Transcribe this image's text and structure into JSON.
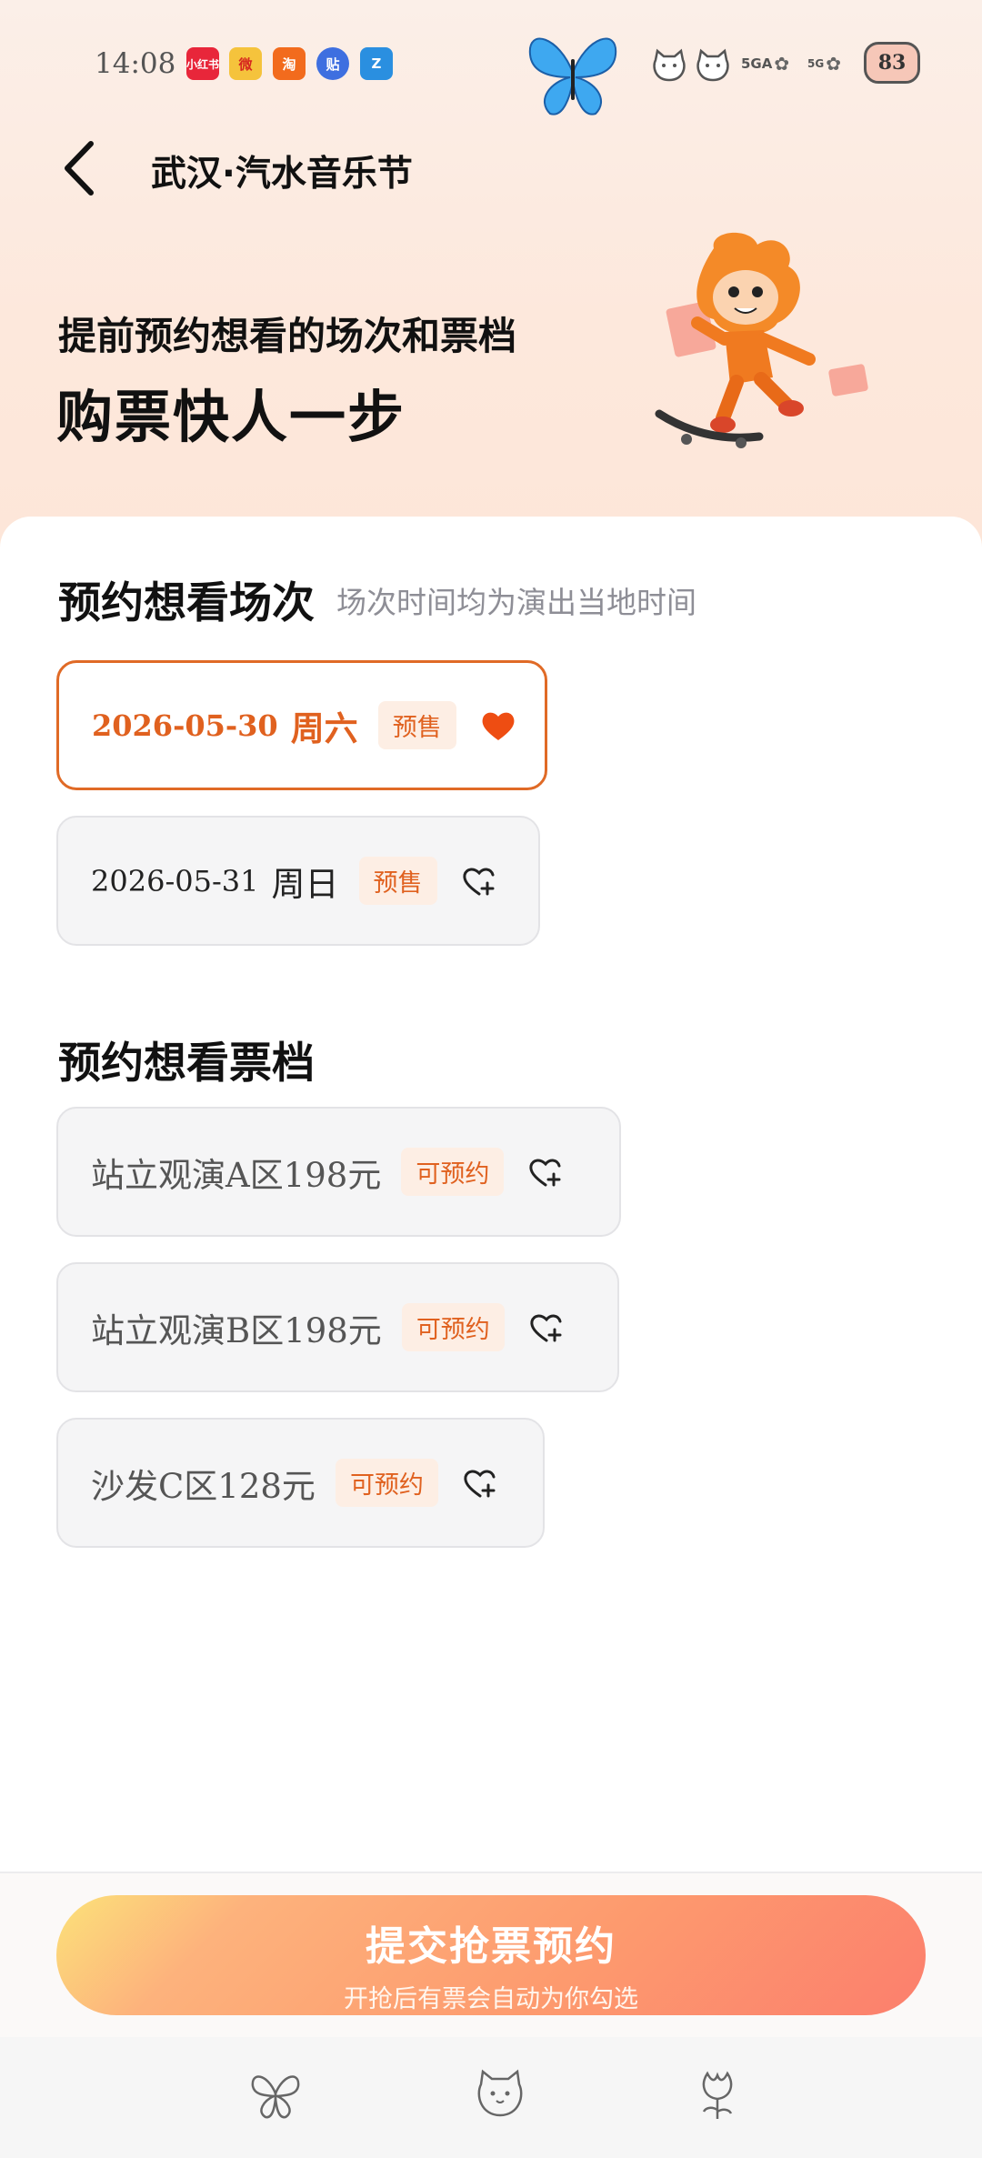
{
  "status_bar": {
    "time": "14:08",
    "apps": [
      {
        "name": "xiaohongshu-icon",
        "label": "小红书",
        "color": "#e8263a"
      },
      {
        "name": "weibo-icon",
        "label": "微",
        "color": "#f5c33c"
      },
      {
        "name": "taobao-icon",
        "label": "淘",
        "color": "#f26b1d"
      },
      {
        "name": "tieba-icon",
        "label": "贴",
        "color": "#3e6fe0"
      },
      {
        "name": "zhejiang-tv-icon",
        "label": "Z",
        "color": "#2a8fe0"
      }
    ],
    "net1": "5GA",
    "net2": "5G",
    "battery": "83"
  },
  "nav": {
    "title": "武汉·汽水音乐节"
  },
  "hero": {
    "subtitle": "提前预约想看的场次和票档",
    "title": "购票快人一步"
  },
  "sessions": {
    "title": "预约想看场次",
    "note": "场次时间均为演出当地时间",
    "items": [
      {
        "date": "2026-05-30",
        "day": "周六",
        "badge": "预售",
        "selected": true
      },
      {
        "date": "2026-05-31",
        "day": "周日",
        "badge": "预售",
        "selected": false
      }
    ]
  },
  "tickets": {
    "title": "预约想看票档",
    "items": [
      {
        "name": "站立观演A区198元",
        "badge": "可预约"
      },
      {
        "name": "站立观演B区198元",
        "badge": "可预约"
      },
      {
        "name": "沙发C区128元",
        "badge": "可预约"
      }
    ]
  },
  "submit": {
    "label": "提交抢票预约",
    "sublabel": "开抢后有票会自动为你勾选"
  },
  "bottom_bar": {
    "icons": [
      "butterfly-icon",
      "cat-face-icon",
      "tulip-icon"
    ]
  },
  "colors": {
    "accent": "#e0611f",
    "badge_bg": "#fdeee4",
    "button_start": "#fce27a",
    "button_end": "#fc7f6d"
  }
}
